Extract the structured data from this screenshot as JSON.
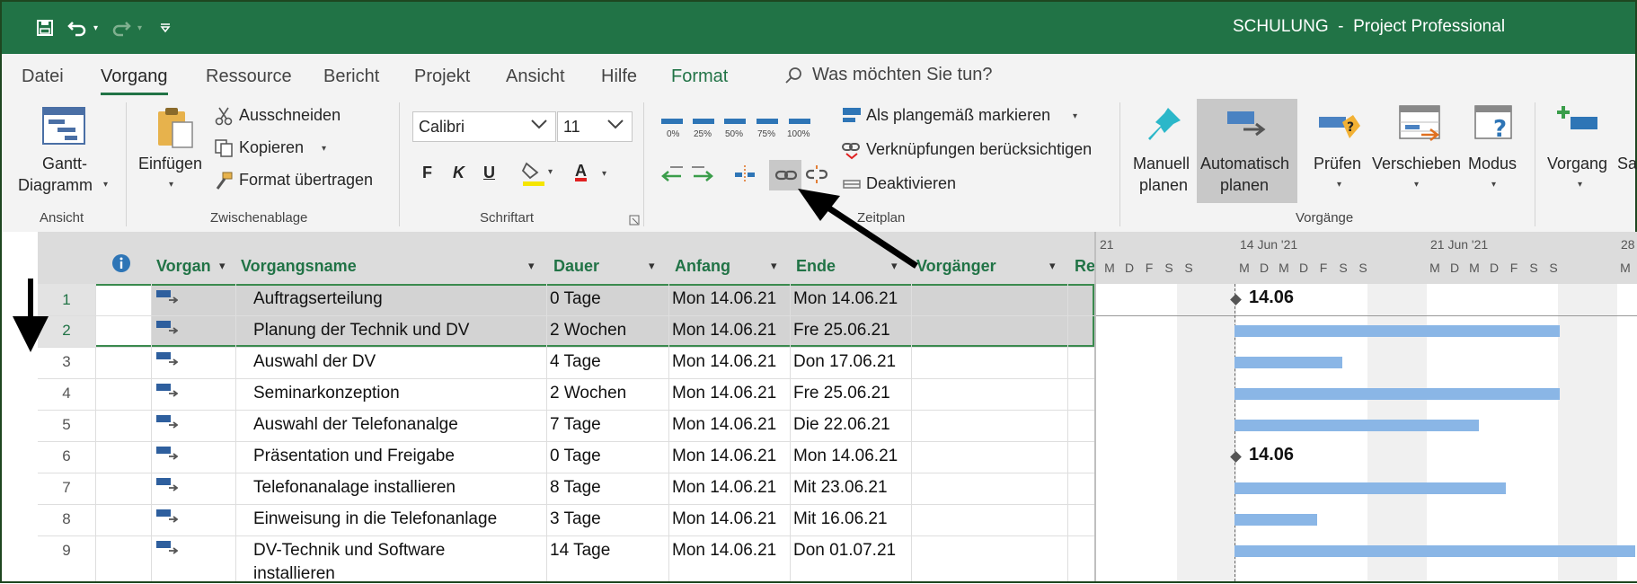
{
  "window": {
    "title": "SCHULUNG  -  Project Professional"
  },
  "menu": {
    "tabs": [
      "Datei",
      "Vorgang",
      "Ressource",
      "Bericht",
      "Projekt",
      "Ansicht",
      "Hilfe",
      "Format"
    ],
    "active_tab": "Vorgang",
    "tell_me": "Was möchten Sie tun?"
  },
  "ribbon": {
    "ansicht": {
      "label": "Ansicht",
      "gantt_line1": "Gantt-",
      "gantt_line2": "Diagramm"
    },
    "zwischenablage": {
      "label": "Zwischenablage",
      "einfuegen": "Einfügen",
      "ausschneiden": "Ausschneiden",
      "kopieren": "Kopieren",
      "format_uebertragen": "Format übertragen"
    },
    "schriftart": {
      "label": "Schriftart",
      "font": "Calibri",
      "size": "11",
      "bold": "F",
      "italic": "K",
      "underline": "U",
      "font_color_letter": "A"
    },
    "zeitplan": {
      "label": "Zeitplan",
      "pct": [
        "0%",
        "25%",
        "50%",
        "75%",
        "100%"
      ],
      "markieren": "Als plangemäß markieren",
      "verknuepfungen": "Verknüpfungen berücksichtigen",
      "deaktivieren": "Deaktivieren"
    },
    "vorgaenge": {
      "label": "Vorgänge",
      "manuell_1": "Manuell",
      "manuell_2": "planen",
      "auto_1": "Automatisch",
      "auto_2": "planen",
      "pruefen": "Prüfen",
      "verschieben": "Verschieben",
      "modus": "Modus"
    },
    "einfuegen": {
      "vorgang": "Vorgang",
      "sammel": "Sa"
    }
  },
  "table": {
    "columns": [
      "Vorgan",
      "Vorgangsname",
      "Dauer",
      "Anfang",
      "Ende",
      "Vorgänger",
      "Re"
    ],
    "rows": [
      {
        "id": "1",
        "name": "Auftragserteilung",
        "duration": "0 Tage",
        "start": "Mon 14.06.21",
        "end": "Mon 14.06.21"
      },
      {
        "id": "2",
        "name": "Planung der Technik und DV",
        "duration": "2 Wochen",
        "start": "Mon 14.06.21",
        "end": "Fre 25.06.21"
      },
      {
        "id": "3",
        "name": "Auswahl der DV",
        "duration": "4 Tage",
        "start": "Mon 14.06.21",
        "end": "Don 17.06.21"
      },
      {
        "id": "4",
        "name": "Seminarkonzeption",
        "duration": "2 Wochen",
        "start": "Mon 14.06.21",
        "end": "Fre 25.06.21"
      },
      {
        "id": "5",
        "name": "Auswahl der Telefonanalge",
        "duration": "7 Tage",
        "start": "Mon 14.06.21",
        "end": "Die 22.06.21"
      },
      {
        "id": "6",
        "name": "Präsentation und Freigabe",
        "duration": "0 Tage",
        "start": "Mon 14.06.21",
        "end": "Mon 14.06.21"
      },
      {
        "id": "7",
        "name": "Telefonanalage installieren",
        "duration": "8 Tage",
        "start": "Mon 14.06.21",
        "end": "Mit 23.06.21"
      },
      {
        "id": "8",
        "name": "Einweisung in die Telefonanlage",
        "duration": "3 Tage",
        "start": "Mon 14.06.21",
        "end": "Mit 16.06.21"
      },
      {
        "id": "9",
        "name": "DV-Technik und Software",
        "name2": "installieren",
        "duration": "14 Tage",
        "start": "Mon 14.06.21",
        "end": "Don 01.07.21"
      }
    ]
  },
  "gantt": {
    "weeks": [
      "21",
      "14 Jun '21",
      "21 Jun '21",
      "28"
    ],
    "days": [
      "M",
      "D",
      "F",
      "S",
      "S",
      "M",
      "D",
      "M",
      "D",
      "F",
      "S",
      "S",
      "M",
      "D",
      "M",
      "D",
      "F",
      "S",
      "S",
      "M"
    ],
    "milestone_1": "14.06",
    "milestone_2": "14.06"
  },
  "colors": {
    "accent": "#217346",
    "bar": "#8ab6e6"
  }
}
